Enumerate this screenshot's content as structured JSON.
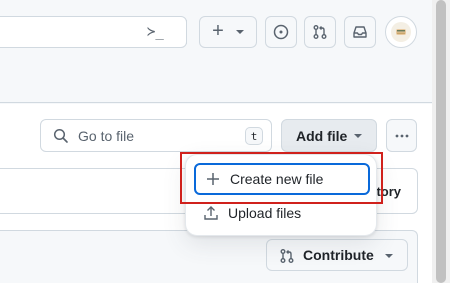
{
  "header": {
    "command_palette_glyph": "≻_",
    "new_button_plus": "+",
    "avatar_icon": "avatar-icon"
  },
  "toolbar": {
    "goto_file_placeholder": "Go to file",
    "goto_file_shortcut": "t",
    "add_file_label": "Add file",
    "more_icon": "kebab-horizontal-icon"
  },
  "menu": {
    "items": [
      {
        "label": "Create new file",
        "icon": "plus-icon"
      },
      {
        "label": "Upload files",
        "icon": "upload-icon"
      }
    ]
  },
  "panel": {
    "partial_text": "tory"
  },
  "contribute": {
    "label": "Contribute",
    "icon": "git-pull-request-icon"
  },
  "colors": {
    "accent_blue": "#0969da",
    "highlight_red": "#d0211c",
    "border": "#d1d9e0",
    "canvas_subtle": "#f6f8fa"
  }
}
